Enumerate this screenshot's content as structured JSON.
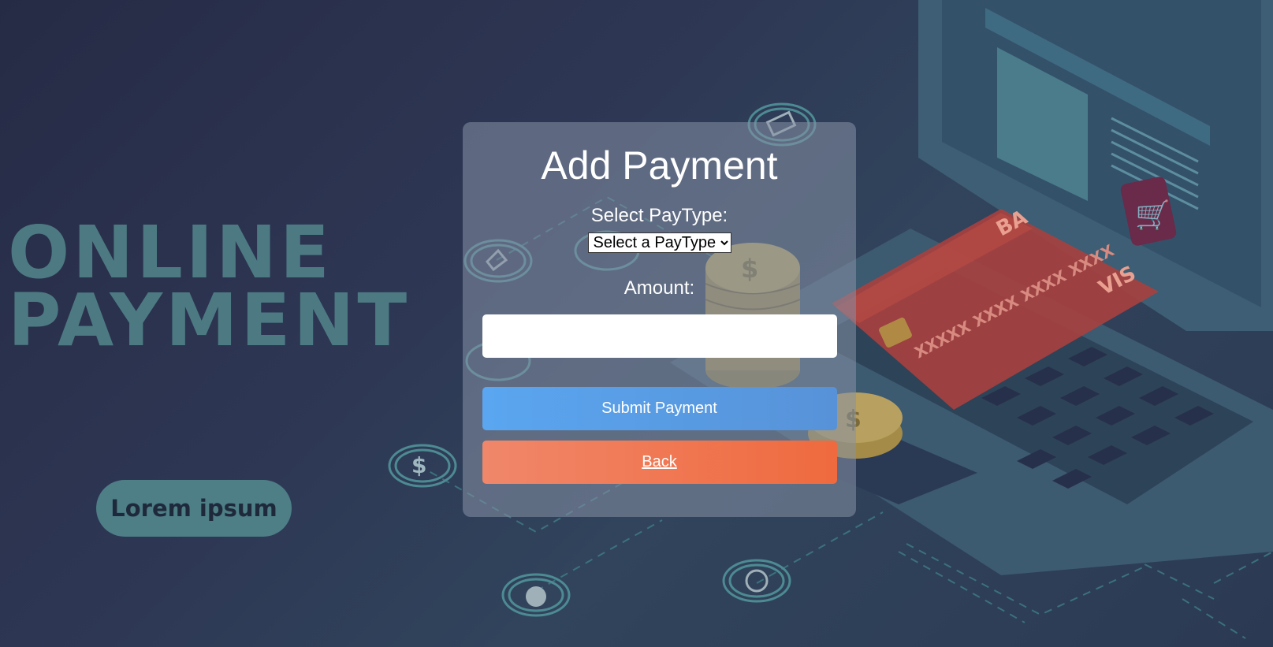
{
  "background": {
    "headline_line1": "ONLINE",
    "headline_line2": "PAYMENT",
    "pill_text": "Lorem ipsum",
    "card_art_text": [
      "BA",
      "XXXXX XXXX XXXX XXXX",
      "VIS"
    ]
  },
  "form": {
    "title": "Add Payment",
    "paytype_label": "Select PayType:",
    "paytype_selected": "Select a PayType",
    "amount_label": "Amount:",
    "amount_value": "",
    "submit_label": "Submit Payment",
    "back_label": "Back"
  },
  "colors": {
    "submit_button": "#5aa6f0",
    "back_button": "#ef6a3e",
    "headline": "#4d7a82"
  }
}
